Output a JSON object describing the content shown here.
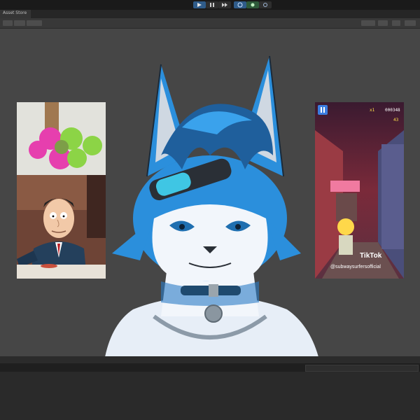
{
  "window": {
    "tab_title": "Asset Store"
  },
  "toolbar": {
    "play_label": "Play",
    "pause_label": "Pause",
    "step_label": "Step"
  },
  "overlays": {
    "tiktok_brand": "TikTok",
    "tiktok_handle": "@subwaysurfersofficial",
    "game_score": "000348",
    "game_coins": "43",
    "game_multiplier": "x1"
  },
  "colors": {
    "accent_blue": "#2f5c8a",
    "viewport_bg": "#464646",
    "character_blue": "#2b8fdc"
  },
  "icons": [
    "play-icon",
    "pause-icon",
    "step-icon",
    "layers-icon",
    "account-icon",
    "cloud-icon",
    "search-icon",
    "gear-icon"
  ]
}
